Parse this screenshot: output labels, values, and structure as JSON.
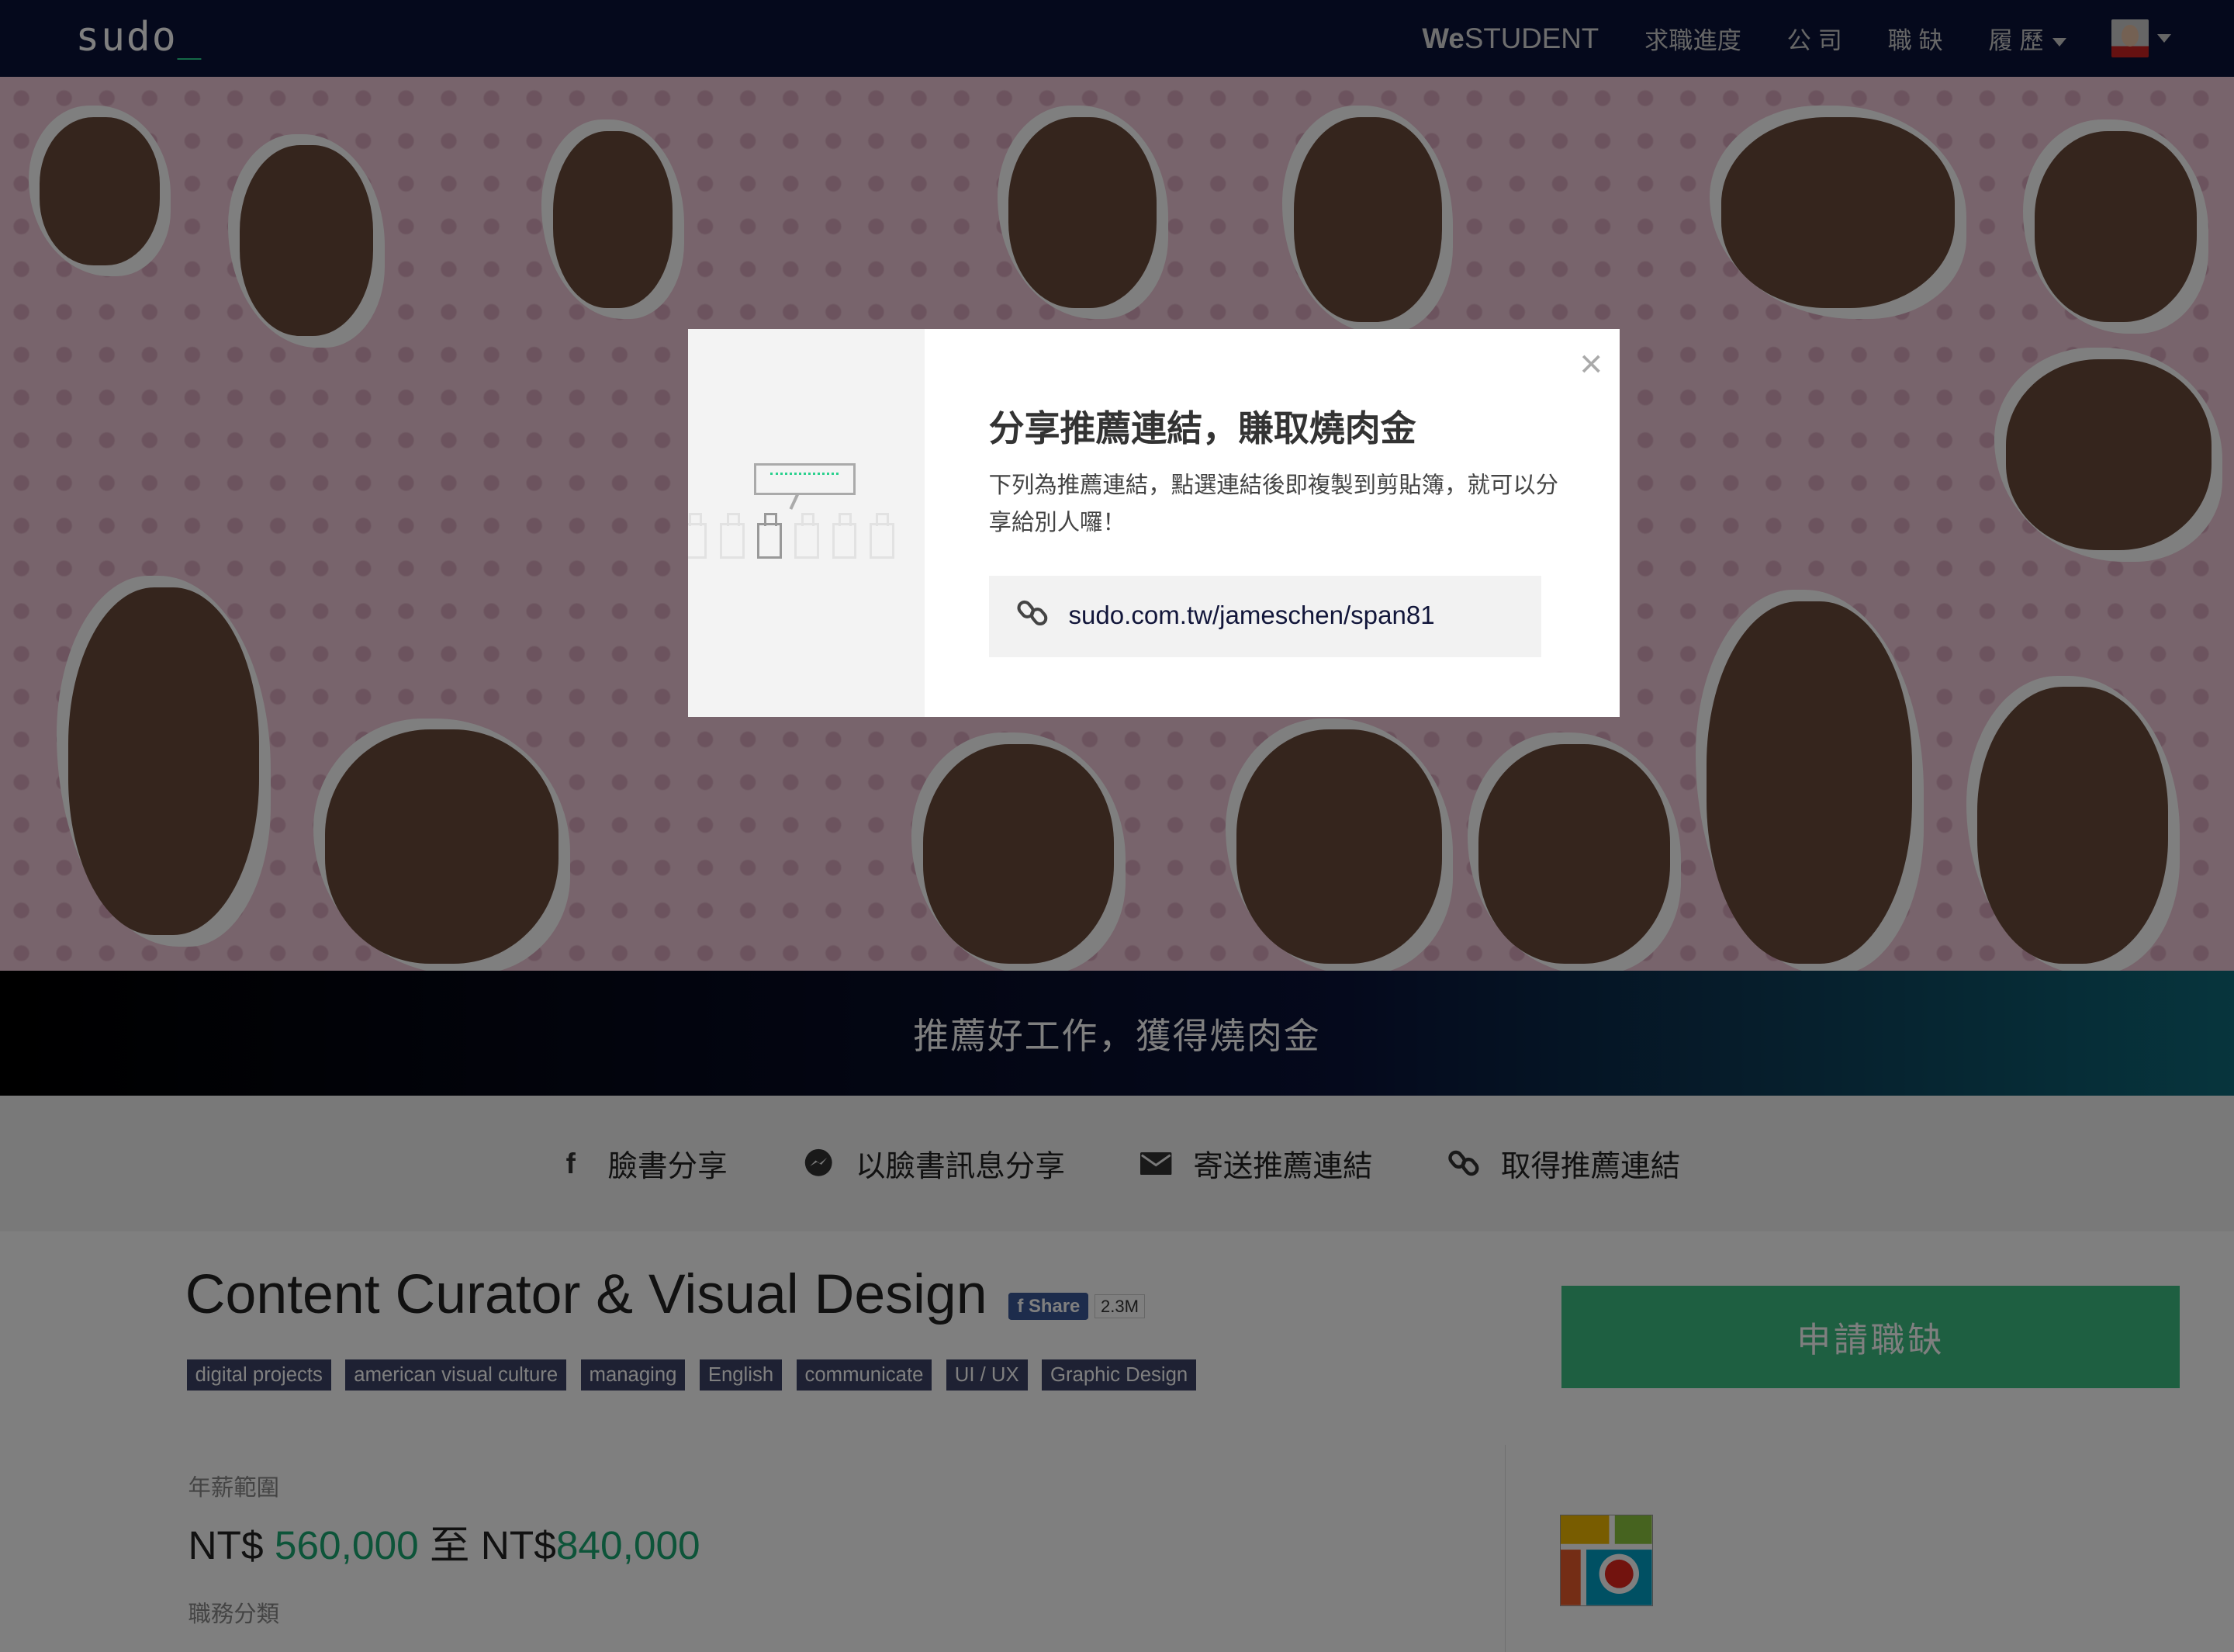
{
  "nav": {
    "logo": "sudo",
    "logo_cursor": "_",
    "westudent_bold": "We",
    "westudent_rest": "STUDENT",
    "items": [
      "求職進度",
      "公 司",
      "職 缺",
      "履 歷"
    ]
  },
  "banner": {
    "text": "推薦好工作，獲得燒肉金"
  },
  "share": {
    "items": [
      {
        "icon": "facebook-icon",
        "label": "臉書分享"
      },
      {
        "icon": "messenger-icon",
        "label": "以臉書訊息分享"
      },
      {
        "icon": "envelope-icon",
        "label": "寄送推薦連結"
      },
      {
        "icon": "link-icon",
        "label": "取得推薦連結"
      }
    ]
  },
  "job": {
    "title": "Content Curator & Visual Design",
    "fb_share_label": "Share",
    "fb_share_count": "2.3M",
    "tags": [
      "digital projects",
      "american visual culture",
      "managing",
      "English",
      "communicate",
      "UI / UX",
      "Graphic Design"
    ],
    "apply_label": "申請職缺",
    "salary_label": "年薪範圍",
    "salary_currency": "NT$",
    "salary_min": "560,000",
    "salary_to": "至",
    "salary_max": "840,000",
    "category_label": "職務分類"
  },
  "modal": {
    "title": "分享推薦連結，賺取燒肉金",
    "description": "下列為推薦連結，點選連結後即複製到剪貼簿，就可以分享給別人囉！",
    "link": "sudo.com.tw/jameschen/span81",
    "close": "×"
  },
  "colors": {
    "accent": "#3dbf83",
    "nav_bg": "#0a1238",
    "tag_bg": "#3d4266"
  }
}
